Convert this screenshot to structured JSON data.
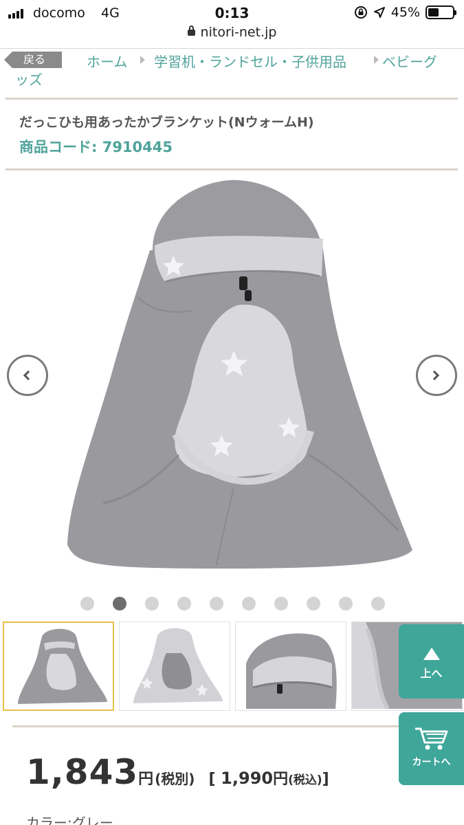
{
  "status_bar": {
    "carrier": "docomo",
    "network": "4G",
    "time": "0:13",
    "battery": "45%",
    "battery_level": 0.45
  },
  "browser": {
    "url": "nitori-net.jp"
  },
  "breadcrumb": {
    "back_label": "戻る",
    "items": [
      "ホーム",
      "学習机・ランドセル・子供用品",
      "ベビーグ",
      "ッズ"
    ]
  },
  "product": {
    "name": "だっこひも用あったかブランケット(NウォームH)",
    "code_label": "商品コード: ",
    "code": "7910445"
  },
  "gallery": {
    "total_images": 10,
    "active_index": 2,
    "thumbnails_visible": 4,
    "selected_thumbnail": 1
  },
  "price": {
    "amount": "1,843",
    "yen": "円",
    "tax_excluded": "(税別)",
    "incl_open": "[ ",
    "incl_amount": "1,990",
    "incl_yen": "円",
    "incl_label": "(税込)",
    "incl_close": "]"
  },
  "color": {
    "label": "カラー:グレー"
  },
  "floating": {
    "top_label": "上へ",
    "cart_label": "カートへ"
  },
  "colors": {
    "accent": "#4fa39b",
    "float_bg": "#3fa69a",
    "blanket": "#9a999e",
    "fleece": "#d6d5d9",
    "selected_border": "#e8c04a"
  }
}
